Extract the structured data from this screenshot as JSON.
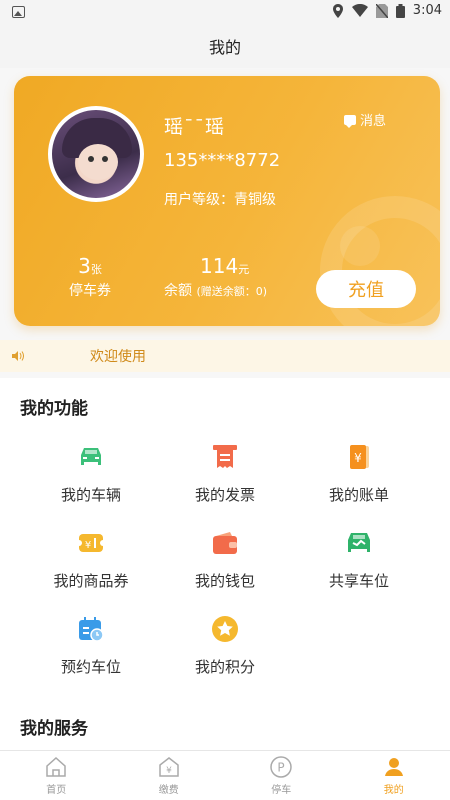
{
  "status_bar": {
    "time": "3:04"
  },
  "header": {
    "title": "我的"
  },
  "profile": {
    "username": "瑶¯¯瑶",
    "phone": "135****8772",
    "level": "用户等级：青铜级",
    "message_label": "消息",
    "coupons_value": "3",
    "coupons_unit": "张",
    "coupons_label": "停车券",
    "balance_value": "114",
    "balance_unit": "元",
    "balance_label": "余额",
    "gift_balance": "(赠送余额：0)",
    "recharge_label": "充值"
  },
  "notice": {
    "text": "欢迎使用"
  },
  "functions": {
    "title": "我的功能",
    "items": [
      {
        "label": "我的车辆",
        "icon": "car-icon"
      },
      {
        "label": "我的发票",
        "icon": "invoice-icon"
      },
      {
        "label": "我的账单",
        "icon": "bill-icon"
      },
      {
        "label": "我的商品券",
        "icon": "voucher-icon"
      },
      {
        "label": "我的钱包",
        "icon": "wallet-icon"
      },
      {
        "label": "共享车位",
        "icon": "shared-parking-icon"
      },
      {
        "label": "预约车位",
        "icon": "reserve-parking-icon"
      },
      {
        "label": "我的积分",
        "icon": "points-icon"
      }
    ]
  },
  "services": {
    "title": "我的服务"
  },
  "tabbar": {
    "items": [
      {
        "label": "首页",
        "icon": "home-icon"
      },
      {
        "label": "缴费",
        "icon": "payment-icon"
      },
      {
        "label": "停车",
        "icon": "parking-icon"
      },
      {
        "label": "我的",
        "icon": "profile-icon"
      }
    ],
    "active_index": 3
  },
  "colors": {
    "accent": "#f0a020",
    "card_start": "#f0a924",
    "card_end": "#f8c25a",
    "green": "#3cc07a",
    "red_orange": "#f26b4a",
    "blue": "#3a9be8",
    "yellow": "#f5b82e"
  }
}
